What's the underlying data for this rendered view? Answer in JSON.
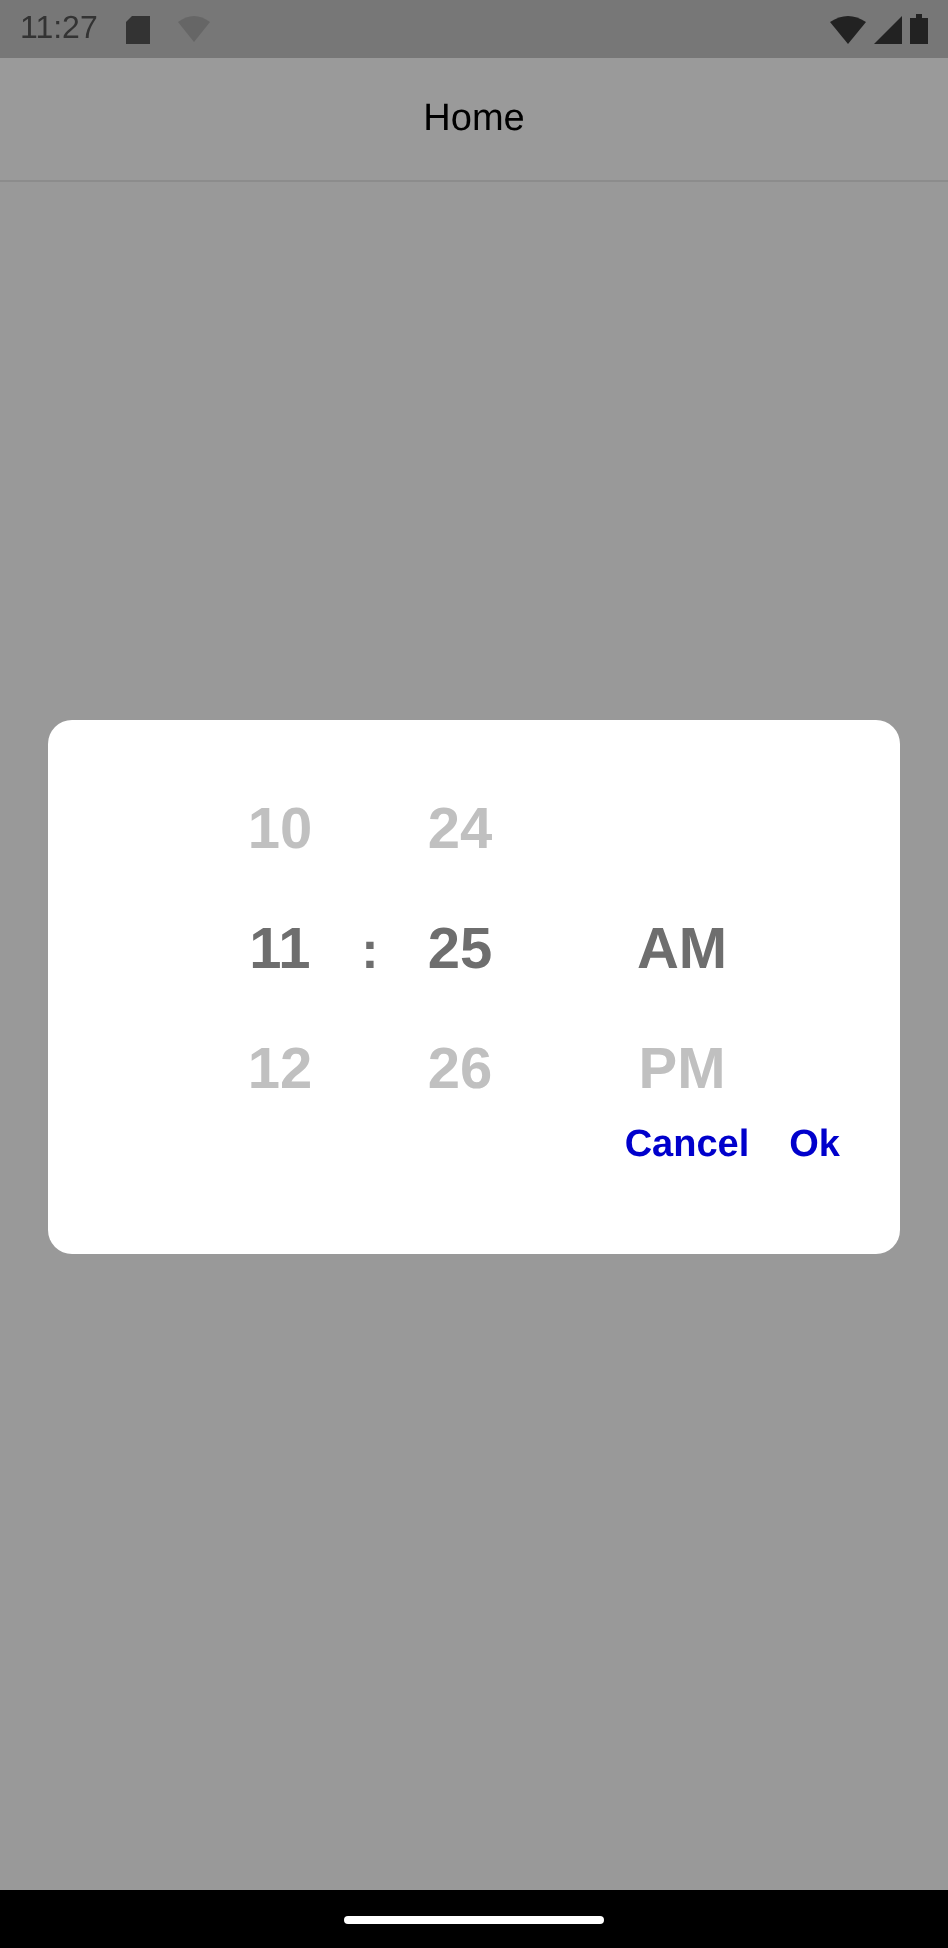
{
  "status_bar": {
    "time": "11:27"
  },
  "app_bar": {
    "title": "Home"
  },
  "time_picker": {
    "hours": [
      {
        "label": "10",
        "selected": false
      },
      {
        "label": "11",
        "selected": true
      },
      {
        "label": "12",
        "selected": false
      }
    ],
    "separator": ":",
    "minutes": [
      {
        "label": "24",
        "selected": false
      },
      {
        "label": "25",
        "selected": true
      },
      {
        "label": "26",
        "selected": false
      }
    ],
    "periods": [
      {
        "label": "AM",
        "selected": true
      },
      {
        "label": "PM",
        "selected": false
      }
    ]
  },
  "buttons": [
    {
      "label": "Cancel"
    },
    {
      "label": "Ok"
    }
  ]
}
